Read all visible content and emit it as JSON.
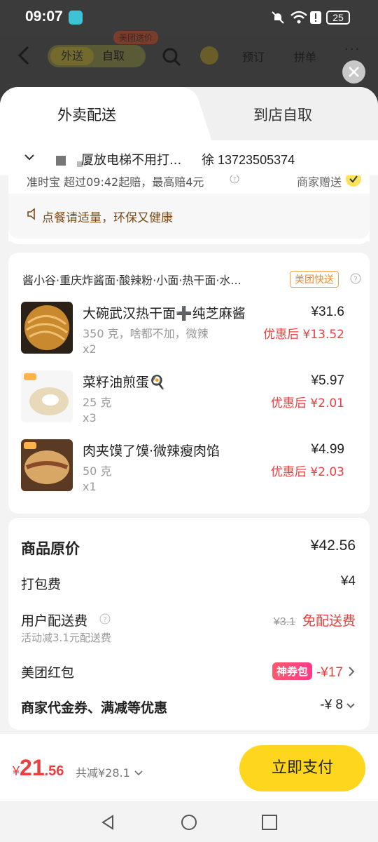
{
  "status_bar": {
    "time": "09:07",
    "battery": "25"
  },
  "background_header": {
    "tab_delivery": "外送",
    "tab_pickup": "自取",
    "promo_badge": "美团送价",
    "reserve": "预订",
    "group": "拼单",
    "more": "···"
  },
  "tabs": {
    "delivery": "外卖配送",
    "pickup": "到店自取"
  },
  "address": {
    "text": "厦放电梯不用打...",
    "contact": "徐  13723505374"
  },
  "guarantee": {
    "text": "准时宝   超过09:42起赔，最高赔4元",
    "merchant_gift": "商家赠送",
    "tip": "点餐请适量，环保又健康"
  },
  "store": {
    "name": "酱小谷·重庆炸酱面·酸辣粉·小面·热干面·水...",
    "delivery_badge": "美团快送"
  },
  "items": [
    {
      "name": "大碗武汉热干面➕纯芝麻酱",
      "spec": "350 克，啥都不加，微辣",
      "qty": "x2",
      "price": "¥31.6",
      "discount": "优惠后 ¥13.52"
    },
    {
      "name": "菜籽油煎蛋🍳",
      "spec": "25 克",
      "qty": "x3",
      "price": "¥5.97",
      "discount": "优惠后 ¥2.01"
    },
    {
      "name": "肉夹馍了馍·微辣瘦肉馅",
      "spec": "50 克",
      "qty": "x1",
      "price": "¥4.99",
      "discount": "优惠后 ¥2.03"
    }
  ],
  "summary": {
    "original_label": "商品原价",
    "original_value": "¥42.56",
    "packing_label": "打包费",
    "packing_value": "¥4",
    "delivery_label": "用户配送费",
    "delivery_note": "活动减3.1元配送费",
    "delivery_old": "¥3.1",
    "delivery_free": "免配送费",
    "redpack_label": "美团红包",
    "redpack_tag": "神券包",
    "redpack_value": "-¥17",
    "coupon_label": "商家代金券、满减等优惠",
    "coupon_value": "-¥ 8"
  },
  "bottom_bar": {
    "currency": "¥",
    "total_int": "21",
    "total_dec": ".56",
    "saved": "共减¥28.1",
    "pay": "立即支付"
  },
  "colors": {
    "accent_yellow": "#ffd61e",
    "price_red": "#ee3d3d",
    "tip_brown": "#7a4b18"
  }
}
